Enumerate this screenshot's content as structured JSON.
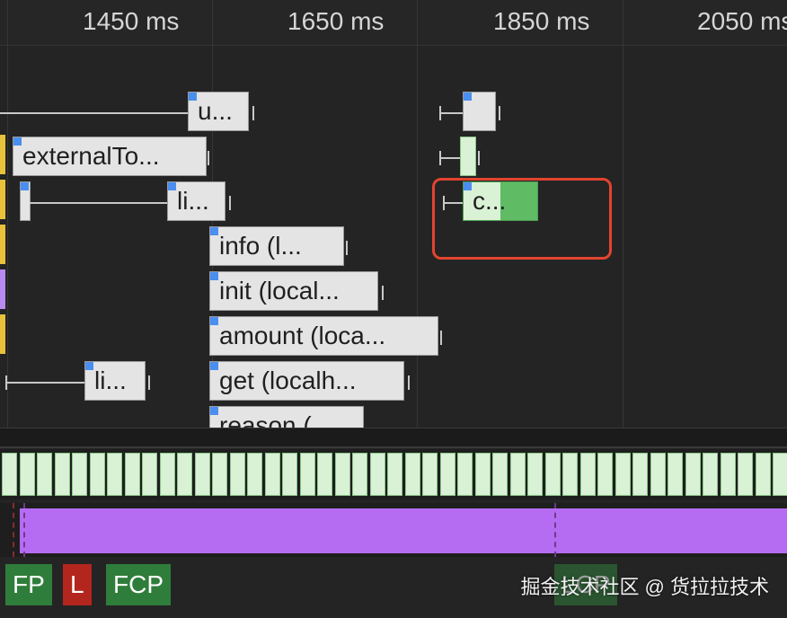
{
  "ruler": {
    "ticks": [
      "1450 ms",
      "1650 ms",
      "1850 ms",
      "2050 ms"
    ]
  },
  "flame": {
    "bars": {
      "u": "u...",
      "external_to": "externalTo...",
      "li_1": "li...",
      "c": "c...",
      "info": "info (l...",
      "init": "init (local...",
      "amount": "amount (loca...",
      "li_2": "li...",
      "get": "get (localh...",
      "reason": "reason (..."
    }
  },
  "timings": {
    "fp": "FP",
    "l": "L",
    "fcp": "FCP",
    "lcp": "LCP"
  },
  "colors": {
    "fp": "#2f7d3a",
    "l": "#b3261e",
    "fcp": "#2f7d3a",
    "main_task": "#b56cf3",
    "frame": "#d9f1d5",
    "highlight": "#e2442f"
  },
  "watermark": "掘金技术社区 @ 货拉拉技术"
}
